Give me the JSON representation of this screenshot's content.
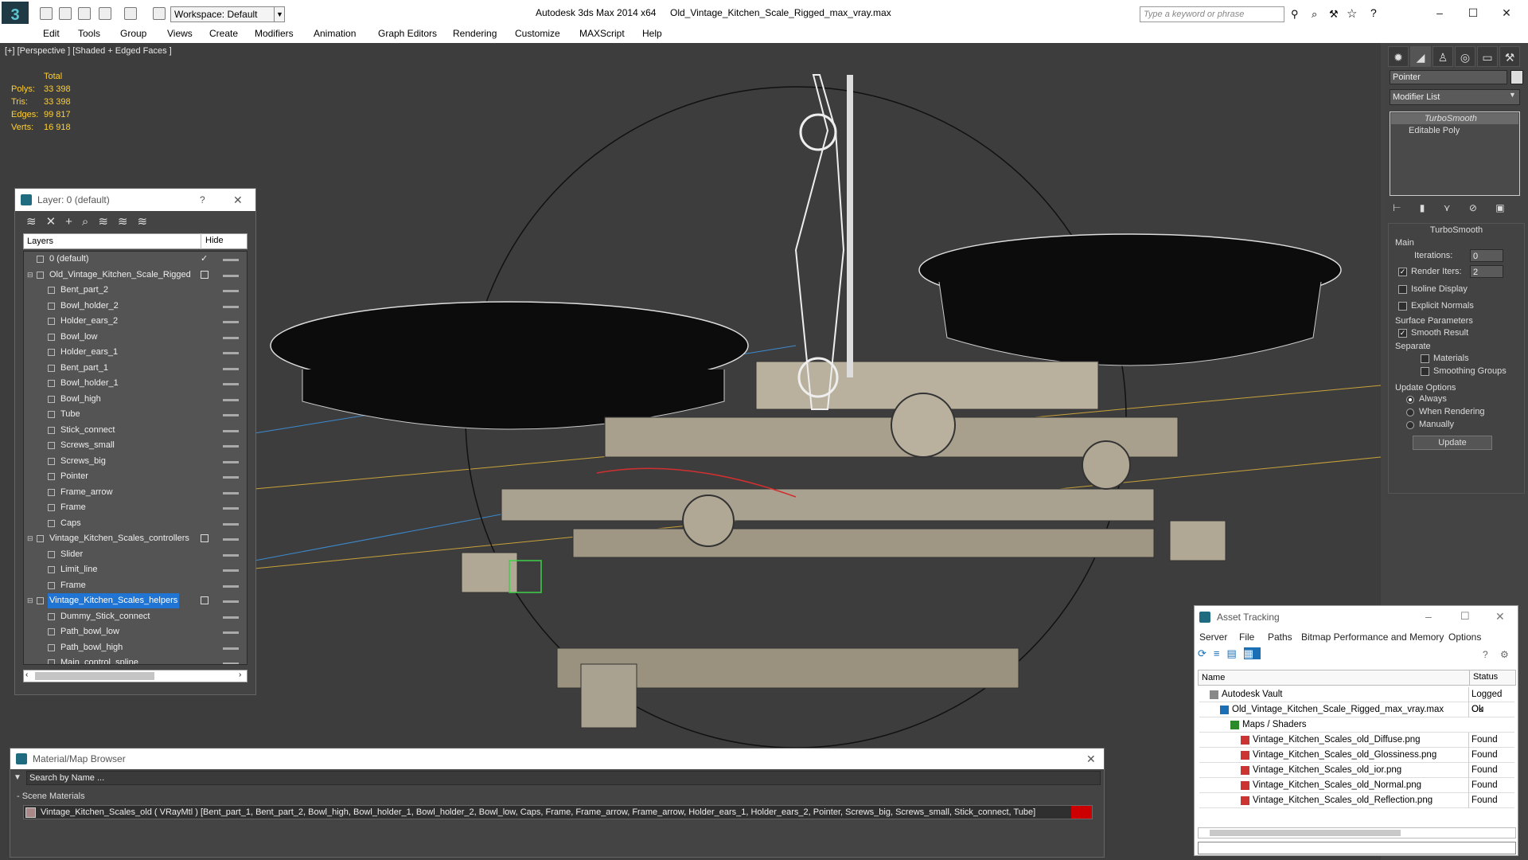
{
  "title": {
    "workspace": "Workspace: Default",
    "app": "Autodesk 3ds Max  2014 x64",
    "file": "Old_Vintage_Kitchen_Scale_Rigged_max_vray.max",
    "search_placeholder": "Type a keyword or phrase"
  },
  "menu": [
    "Edit",
    "Tools",
    "Group",
    "Views",
    "Create",
    "Modifiers",
    "Animation",
    "Graph Editors",
    "Rendering",
    "Customize",
    "MAXScript",
    "Help"
  ],
  "viewport": {
    "label": "[+] [Perspective ] [Shaded + Edged Faces ]",
    "stats_header": "Total",
    "stats": [
      {
        "k": "Polys:",
        "v": "33 398"
      },
      {
        "k": "Tris:",
        "v": "33 398"
      },
      {
        "k": "Edges:",
        "v": "99 817"
      },
      {
        "k": "Verts:",
        "v": "16 918"
      }
    ]
  },
  "command_panel": {
    "name_field": "Pointer",
    "modifier_list": "Modifier List",
    "stack": [
      "TurboSmooth",
      "Editable Poly"
    ],
    "rollout_title": "TurboSmooth",
    "main_label": "Main",
    "iterations_label": "Iterations:",
    "iterations": "0",
    "render_iters_label": "Render Iters:",
    "render_iters": "2",
    "isoline": "Isoline Display",
    "explicit_normals": "Explicit Normals",
    "surface_params": "Surface Parameters",
    "smooth_result": "Smooth Result",
    "separate": "Separate",
    "materials": "Materials",
    "smoothing_groups": "Smoothing Groups",
    "update_options": "Update Options",
    "always": "Always",
    "when_rendering": "When Rendering",
    "manually": "Manually",
    "update_btn": "Update"
  },
  "layer_window": {
    "title": "Layer: 0 (default)",
    "help": "?",
    "col_layers": "Layers",
    "col_hide": "Hide",
    "rows": [
      {
        "name": "0 (default)",
        "level": 0,
        "type": "layer",
        "check": true
      },
      {
        "name": "Old_Vintage_Kitchen_Scale_Rigged",
        "level": 0,
        "type": "layer",
        "box": true
      },
      {
        "name": "Bent_part_2",
        "level": 1,
        "type": "obj"
      },
      {
        "name": "Bowl_holder_2",
        "level": 1,
        "type": "obj"
      },
      {
        "name": "Holder_ears_2",
        "level": 1,
        "type": "obj"
      },
      {
        "name": "Bowl_low",
        "level": 1,
        "type": "obj"
      },
      {
        "name": "Holder_ears_1",
        "level": 1,
        "type": "obj"
      },
      {
        "name": "Bent_part_1",
        "level": 1,
        "type": "obj"
      },
      {
        "name": "Bowl_holder_1",
        "level": 1,
        "type": "obj"
      },
      {
        "name": "Bowl_high",
        "level": 1,
        "type": "obj"
      },
      {
        "name": "Tube",
        "level": 1,
        "type": "obj"
      },
      {
        "name": "Stick_connect",
        "level": 1,
        "type": "obj"
      },
      {
        "name": "Screws_small",
        "level": 1,
        "type": "obj"
      },
      {
        "name": "Screws_big",
        "level": 1,
        "type": "obj"
      },
      {
        "name": "Pointer",
        "level": 1,
        "type": "obj"
      },
      {
        "name": "Frame_arrow",
        "level": 1,
        "type": "obj"
      },
      {
        "name": "Frame",
        "level": 1,
        "type": "obj"
      },
      {
        "name": "Caps",
        "level": 1,
        "type": "obj"
      },
      {
        "name": "Vintage_Kitchen_Scales_controllers",
        "level": 0,
        "type": "layer",
        "box": true
      },
      {
        "name": "Slider",
        "level": 1,
        "type": "obj"
      },
      {
        "name": "Limit_line",
        "level": 1,
        "type": "obj"
      },
      {
        "name": "Frame",
        "level": 1,
        "type": "obj"
      },
      {
        "name": "Vintage_Kitchen_Scales_helpers",
        "level": 0,
        "type": "layer",
        "box": true,
        "selected": true
      },
      {
        "name": "Dummy_Stick_connect",
        "level": 1,
        "type": "obj"
      },
      {
        "name": "Path_bowl_low",
        "level": 1,
        "type": "obj"
      },
      {
        "name": "Path_bowl_high",
        "level": 1,
        "type": "obj"
      },
      {
        "name": "Main_control_spline",
        "level": 1,
        "type": "obj"
      }
    ]
  },
  "material_browser": {
    "title": "Material/Map Browser",
    "search": "Search by Name ...",
    "section": "- Scene Materials",
    "entry": "Vintage_Kitchen_Scales_old  ( VRayMtl ) [Bent_part_1, Bent_part_2, Bowl_high, Bowl_holder_1, Bowl_holder_2, Bowl_low, Caps, Frame, Frame_arrow, Frame_arrow, Holder_ears_1, Holder_ears_2, Pointer, Screws_big, Screws_small, Stick_connect, Tube]"
  },
  "asset_tracking": {
    "title": "Asset Tracking",
    "menu": [
      "Server",
      "File",
      "Paths",
      "Bitmap Performance and Memory",
      "Options"
    ],
    "col_name": "Name",
    "col_status": "Status",
    "rows": [
      {
        "name": "Autodesk Vault",
        "status": "Logged Ou",
        "indent": 1,
        "icon": "vault"
      },
      {
        "name": "Old_Vintage_Kitchen_Scale_Rigged_max_vray.max",
        "status": "Ok",
        "indent": 2,
        "icon": "max"
      },
      {
        "name": "Maps / Shaders",
        "status": "",
        "indent": 3,
        "icon": "maps"
      },
      {
        "name": "Vintage_Kitchen_Scales_old_Diffuse.png",
        "status": "Found",
        "indent": 4,
        "icon": "png"
      },
      {
        "name": "Vintage_Kitchen_Scales_old_Glossiness.png",
        "status": "Found",
        "indent": 4,
        "icon": "png"
      },
      {
        "name": "Vintage_Kitchen_Scales_old_ior.png",
        "status": "Found",
        "indent": 4,
        "icon": "png"
      },
      {
        "name": "Vintage_Kitchen_Scales_old_Normal.png",
        "status": "Found",
        "indent": 4,
        "icon": "png"
      },
      {
        "name": "Vintage_Kitchen_Scales_old_Reflection.png",
        "status": "Found",
        "indent": 4,
        "icon": "png"
      }
    ]
  }
}
